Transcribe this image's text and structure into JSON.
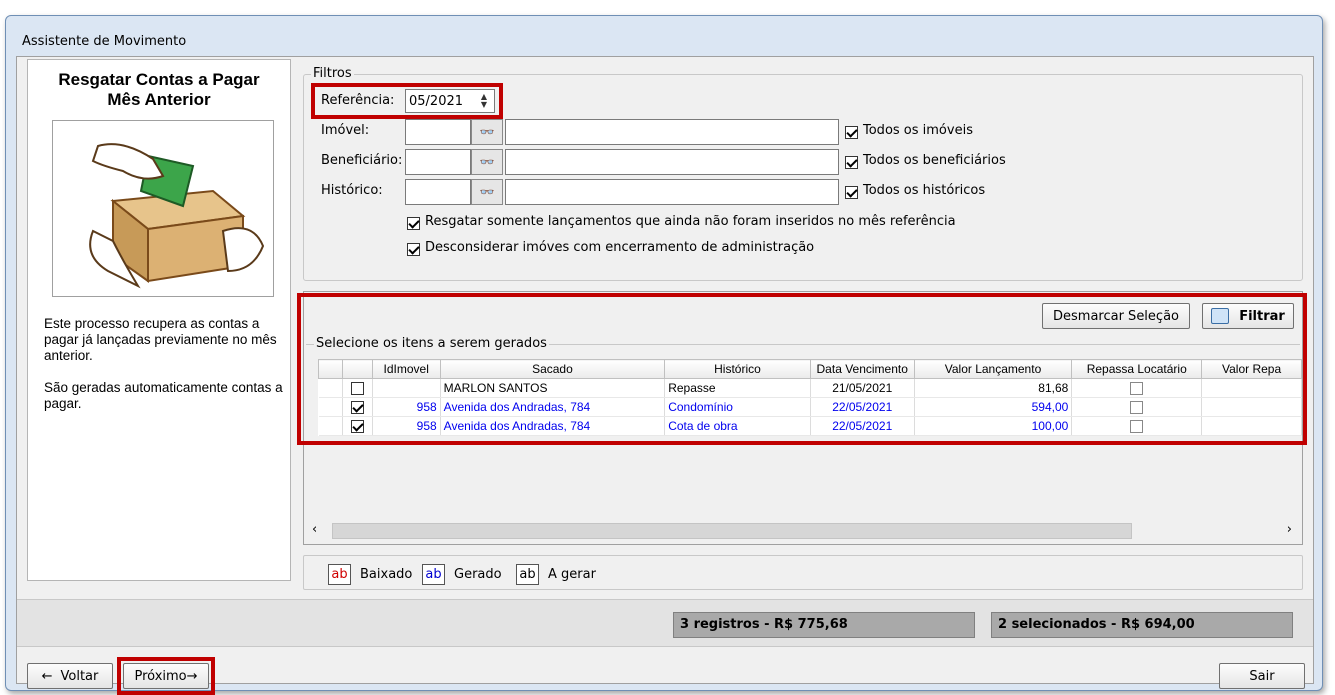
{
  "window": {
    "title": "Assistente de Movimento"
  },
  "left_panel": {
    "title_line1": "Resgatar Contas a Pagar",
    "title_line2": "Mês Anterior",
    "desc1": "Este processo recupera as contas a pagar já lançadas previamente no mês anterior.",
    "desc2": "São geradas automaticamente contas a pagar."
  },
  "filters": {
    "legend": "Filtros",
    "referencia_label": "Referência:",
    "referencia_value": "05/2021",
    "imovel_label": "Imóvel:",
    "beneficiario_label": "Beneficiário:",
    "historico_label": "Histórico:",
    "todos_imoveis": "Todos os imóveis",
    "todos_beneficiarios": "Todos os beneficiários",
    "todos_historicos": "Todos os históricos",
    "resgatar_somente": "Resgatar somente lançamentos que ainda não foram inseridos no mês referência",
    "desconsiderar": "Desconsiderar imóves com encerramento de administração"
  },
  "toolbar": {
    "desmarcar_label": "Desmarcar Seleção",
    "filtrar_label": "Filtrar"
  },
  "grid": {
    "legend": "Selecione os itens a serem gerados",
    "headers": [
      "IdImovel",
      "Sacado",
      "Histórico",
      "Data Vencimento",
      "Valor Lançamento",
      "Repassa Locatário",
      "Valor Repa"
    ],
    "rows": [
      {
        "checked": false,
        "idimovel": "",
        "sacado": "MARLON SANTOS",
        "historico": "Repasse",
        "vencimento": "21/05/2021",
        "valor": "81,68",
        "repassa": false
      },
      {
        "checked": true,
        "idimovel": "958",
        "sacado": "Avenida dos Andradas, 784",
        "historico": "Condomínio",
        "vencimento": "22/05/2021",
        "valor": "594,00",
        "repassa": false
      },
      {
        "checked": true,
        "idimovel": "958",
        "sacado": "Avenida dos Andradas, 784",
        "historico": "Cota de obra",
        "vencimento": "22/05/2021",
        "valor": "100,00",
        "repassa": false
      }
    ]
  },
  "legend_bar": {
    "swatch_text": "ab",
    "baixado": "Baixado",
    "gerado": "Gerado",
    "a_gerar": "A gerar",
    "colors": {
      "baixado": "#d00000",
      "gerado": "#0000d0",
      "a_gerar": "#000000"
    }
  },
  "summary": {
    "registros": "3 registros - R$ 775,68",
    "selecionados": "2 selecionados - R$ 694,00"
  },
  "footer": {
    "voltar_label": "Voltar",
    "proximo_label": "Próximo",
    "sair_label": "Sair"
  },
  "icons": {
    "binoculars": "binoculars-icon",
    "spinner": "spin-updown-icon",
    "filtrar": "filter-search-icon",
    "arrow_left": "arrow-left-icon",
    "arrow_right": "arrow-right-icon"
  },
  "accent_colors": {
    "highlight": "#c00000",
    "link_blue": "#0000ee"
  }
}
